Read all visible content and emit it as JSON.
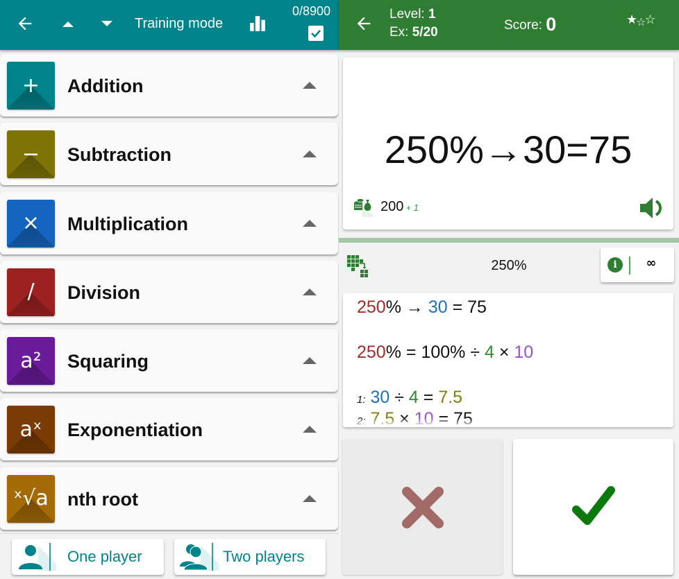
{
  "left_panel": {
    "topbar": {
      "back_icon": "arrow-left-icon",
      "up_icon": "triangle-up-icon",
      "down_icon": "triangle-down-icon",
      "mode_label": "Training mode",
      "stats_icon": "bar-chart-icon",
      "progress_count": "0/8900",
      "checkbox_checked": true
    },
    "operations": [
      {
        "label": "Addition",
        "glyph": "+",
        "icon": "plus-icon",
        "color": "#00838a"
      },
      {
        "label": "Subtraction",
        "glyph": "−",
        "icon": "minus-icon",
        "color": "#7d7306"
      },
      {
        "label": "Multiplication",
        "glyph": "×",
        "icon": "times-icon",
        "color": "#1565c0"
      },
      {
        "label": "Division",
        "glyph": "/",
        "icon": "divide-icon",
        "color": "#9e2121"
      },
      {
        "label": "Squaring",
        "glyph": "a²",
        "icon": "square-icon",
        "color": "#6a1b9a"
      },
      {
        "label": "Exponentiation",
        "glyph": "aˣ",
        "icon": "exponent-icon",
        "color": "#7a3c04"
      },
      {
        "label": "nth root",
        "glyph": "ˣ√a",
        "icon": "root-icon",
        "color": "#a36a06"
      }
    ],
    "players": {
      "one_label": "One player",
      "two_label": "Two players"
    }
  },
  "right_panel": {
    "topbar": {
      "back_icon": "arrow-left-icon",
      "level_label": "Level: ",
      "level_value": "1",
      "exercise_label": "Ex: ",
      "exercise_value": "5/20",
      "score_label": "Score: ",
      "score_value": "0",
      "stars_filled": 1,
      "stars_total": 3
    },
    "question": {
      "expression": "250%→30=75",
      "points": "200",
      "bonus": "+ 1"
    },
    "hint": {
      "label": "250%",
      "info_glyph": "i",
      "limit_glyph": "∞"
    },
    "explanation": {
      "line1": [
        "250",
        "% → ",
        "30",
        " = 75"
      ],
      "line2": [
        "250",
        "% = 100% ÷ ",
        "4",
        " × ",
        "10"
      ],
      "step1": {
        "index": "1:",
        "parts": [
          "30",
          " ÷ ",
          "4",
          " = ",
          "7.5"
        ]
      },
      "step2": {
        "index": "2:",
        "parts": [
          "7.5",
          " × ",
          "10",
          " = 75"
        ]
      }
    },
    "answers": {
      "wrong_icon": "cross-icon",
      "right_icon": "checkmark-icon"
    }
  },
  "colors": {
    "left_accent": "#00838a",
    "right_accent": "#2e7d32",
    "wrong": "#a36b68",
    "right": "#0b7a0b"
  }
}
